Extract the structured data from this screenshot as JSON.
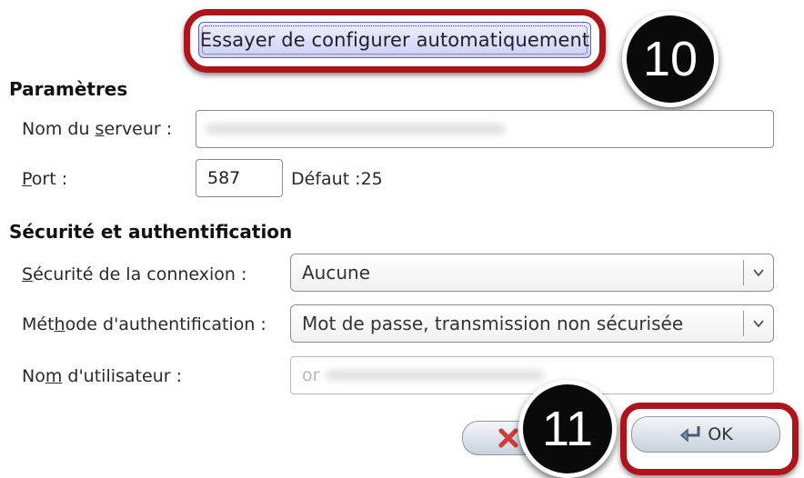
{
  "auto_config": {
    "label": "Essayer de configurer automatiquement"
  },
  "badges": {
    "step_10": "10",
    "step_11": "11"
  },
  "params": {
    "title": "Paramètres",
    "server_label_pre": "Nom du ",
    "server_label_acc": "s",
    "server_label_post": "erveur :",
    "server_value": "",
    "port_label_acc": "P",
    "port_label_post": "ort :",
    "port_value": "587",
    "port_default": "Défaut :25"
  },
  "security": {
    "title": "Sécurité et authentification",
    "conn_label_acc": "S",
    "conn_label_post": "écurité de la connexion :",
    "conn_value": "Aucune",
    "auth_label_pre": "Mét",
    "auth_label_acc": "h",
    "auth_label_post": "ode d'authentification :",
    "auth_value": "Mot de passe, transmission non sécurisée",
    "user_label_pre": "No",
    "user_label_acc": "m",
    "user_label_post": " d'utilisateur :",
    "user_value": "or"
  },
  "buttons": {
    "cancel_label": "A",
    "ok_label": "OK"
  },
  "colors": {
    "highlight": "#b0141b",
    "auto_button": "#cfd0fb",
    "badge": "#0a0a0a"
  }
}
